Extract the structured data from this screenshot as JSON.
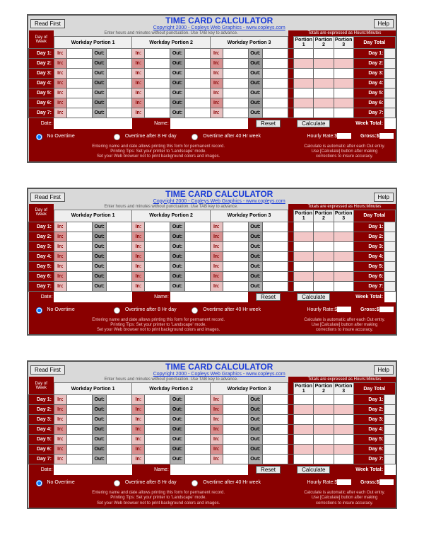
{
  "buttons": {
    "readFirst": "Read First",
    "help": "Help",
    "reset": "Reset",
    "calculate": "Calculate"
  },
  "title": "TIME CARD CALCULATOR",
  "subtitle": "Copyright 2000 - Copleys Web Graphics - www.copleys.com",
  "instructions": "Enter hours and minutes without punctuation. Use TAB key to advance.",
  "totalsNote": "Totals are expressed as Hours:Minutes",
  "headers": {
    "dayOfWeek": "Day of Week",
    "workdayPortion1": "Workday Portion 1",
    "workdayPortion2": "Workday Portion 2",
    "workdayPortion3": "Workday Portion 3",
    "portion1": "Portion 1",
    "portion2": "Portion 2",
    "portion3": "Portion 3",
    "dayTotal": "Day Total",
    "weekTotal": "Week Total:",
    "in": "In:",
    "out": "Out:"
  },
  "days": [
    "Day 1:",
    "Day 2:",
    "Day 3:",
    "Day 4:",
    "Day 5:",
    "Day 6:",
    "Day 7:"
  ],
  "fields": {
    "date": "Date:",
    "name": "Name:",
    "hourlyRate": "Hourly Rate:$",
    "gross": "Gross:$"
  },
  "options": {
    "noOvertime": "No Overtime",
    "after8hr": "Overtime after 8 Hr day",
    "after40hr": "Overtime after 40 Hr week"
  },
  "tips": {
    "left": "Entering name and date allows printing this form for permanent record.\nPrinting Tips: Set your printer to 'Landscape' mode.\nSet your Web browser not to print background colors and images.",
    "right": "Calculate is automatic after each Out entry.\nUse [Calculate] button after making\ncorrections to insure accuracy."
  }
}
